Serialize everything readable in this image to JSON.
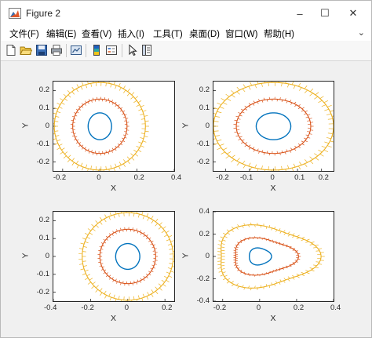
{
  "window": {
    "title": "Figure 2",
    "minimize": "–",
    "maximize": "☐",
    "close": "✕"
  },
  "menu": [
    "文件(F)",
    "编辑(E)",
    "查看(V)",
    "插入(I)",
    "工具(T)",
    "桌面(D)",
    "窗口(W)",
    "帮助(H)"
  ],
  "menu_overflow": "⌄",
  "toolbar_icons": [
    "new-figure-icon",
    "open-file-icon",
    "save-icon",
    "print-icon",
    "link-plot-icon",
    "colorbar-icon",
    "legend-icon",
    "pointer-icon",
    "property-inspector-icon"
  ],
  "colors": {
    "inner": "#0072bd",
    "middle": "#d95319",
    "outer": "#edb120"
  },
  "chart_data": [
    {
      "type": "vector-field",
      "position": "top-left",
      "xlabel": "X",
      "ylabel": "Y",
      "xlim": [
        -0.25,
        0.4
      ],
      "ylim": [
        -0.25,
        0.25
      ],
      "xticks": [
        "-0.2",
        "0",
        "0.2",
        "0.4"
      ],
      "yticks": [
        "0.2",
        "0.1",
        "0",
        "-0.1",
        "-0.2"
      ],
      "series": [
        {
          "color": "inner",
          "cx": 0,
          "cy": 0,
          "rx": 0.063,
          "ry": 0.075,
          "wave": 0
        },
        {
          "color": "middle",
          "cx": 0,
          "cy": 0,
          "rx": 0.146,
          "ry": 0.152,
          "wave": 0
        },
        {
          "color": "outer",
          "cx": 0,
          "cy": 0,
          "rx": 0.245,
          "ry": 0.245,
          "wave": 0
        }
      ]
    },
    {
      "type": "vector-field",
      "position": "top-right",
      "xlabel": "X",
      "ylabel": "Y",
      "xlim": [
        -0.25,
        0.25
      ],
      "ylim": [
        -0.25,
        0.25
      ],
      "xticks": [
        "-0.2",
        "-0.1",
        "0",
        "0.1",
        "0.2"
      ],
      "yticks": [
        "0.2",
        "0.1",
        "0",
        "-0.1",
        "-0.2"
      ],
      "series": [
        {
          "color": "inner",
          "cx": 0,
          "cy": 0,
          "rx": 0.072,
          "ry": 0.075,
          "wave": 0
        },
        {
          "color": "middle",
          "cx": 0,
          "cy": 0,
          "rx": 0.155,
          "ry": 0.152,
          "wave": 0
        },
        {
          "color": "outer",
          "cx": 0,
          "cy": 0,
          "rx": 0.25,
          "ry": 0.245,
          "wave": 0
        }
      ]
    },
    {
      "type": "vector-field",
      "position": "bottom-left",
      "xlabel": "X",
      "ylabel": "Y",
      "xlim": [
        -0.4,
        0.25
      ],
      "ylim": [
        -0.25,
        0.25
      ],
      "xticks": [
        "-0.4",
        "-0.2",
        "0",
        "0.2"
      ],
      "yticks": [
        "0.2",
        "0.1",
        "0",
        "-0.1",
        "-0.2"
      ],
      "series": [
        {
          "color": "inner",
          "cx": 0,
          "cy": 0,
          "rx": 0.065,
          "ry": 0.072,
          "wave": 0
        },
        {
          "color": "middle",
          "cx": 0,
          "cy": 0,
          "rx": 0.15,
          "ry": 0.152,
          "wave": 0
        },
        {
          "color": "outer",
          "cx": 0,
          "cy": 0,
          "rx": 0.245,
          "ry": 0.245,
          "wave": 0
        }
      ]
    },
    {
      "type": "vector-field",
      "position": "bottom-right",
      "xlabel": "X",
      "ylabel": "Y",
      "xlim": [
        -0.25,
        0.4
      ],
      "ylim": [
        -0.4,
        0.4
      ],
      "xticks": [
        "-0.2",
        "0",
        "0.2",
        "0.4"
      ],
      "yticks": [
        "0.4",
        "0.2",
        "0",
        "-0.2",
        "-0.4"
      ],
      "series": [
        {
          "color": "inner",
          "cx": 0,
          "cy": 0,
          "rx": 0.06,
          "ry": 0.075,
          "wave": 0.12
        },
        {
          "color": "middle",
          "cx": 0.02,
          "cy": 0,
          "rx": 0.17,
          "ry": 0.16,
          "wave": 0.12
        },
        {
          "color": "outer",
          "cx": 0.03,
          "cy": 0,
          "rx": 0.27,
          "ry": 0.27,
          "wave": 0.12
        }
      ]
    }
  ]
}
